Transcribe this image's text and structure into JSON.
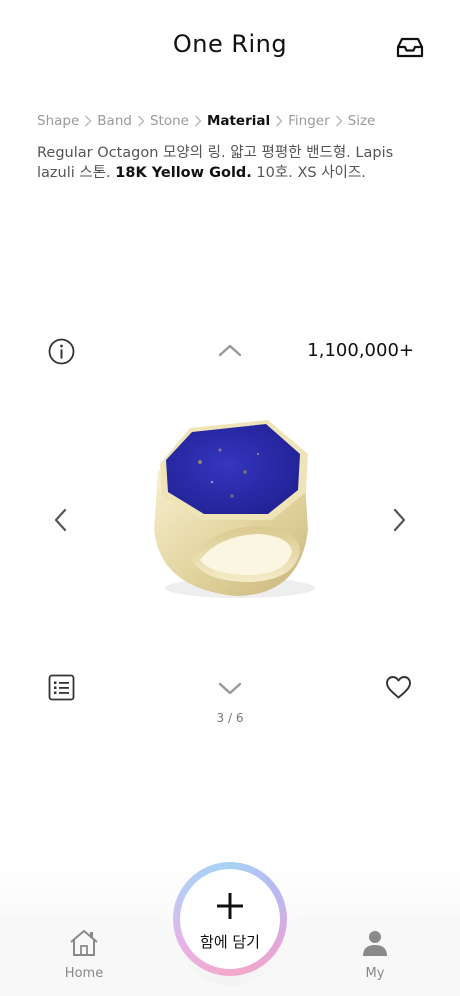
{
  "header": {
    "title": "One Ring"
  },
  "breadcrumb": [
    "Shape",
    "Band",
    "Stone",
    "Material",
    "Finger",
    "Size"
  ],
  "description": {
    "part1": "Regular Octagon 모양의 링. 얇고 평평한 밴드형. Lapis lazuli 스톤. ",
    "bold": "18K Yellow Gold.",
    "part2": " 10호. XS 사이즈."
  },
  "product": {
    "price": "1,100,000+",
    "page": "3 / 6"
  },
  "fab": {
    "label": "함에 담기"
  },
  "nav": {
    "home": "Home",
    "my": "My"
  },
  "icons": [
    "inbox-icon",
    "info-icon",
    "chevron-up-icon",
    "chevron-left-icon",
    "chevron-right-icon",
    "list-icon",
    "chevron-down-icon",
    "heart-icon",
    "plus-icon",
    "home-icon",
    "user-icon"
  ],
  "colors": {
    "stone": "#2a2aa8",
    "gold": "#e8dcaa",
    "fab_gradient": [
      "#a8d2f4",
      "#e6a8d8"
    ]
  }
}
